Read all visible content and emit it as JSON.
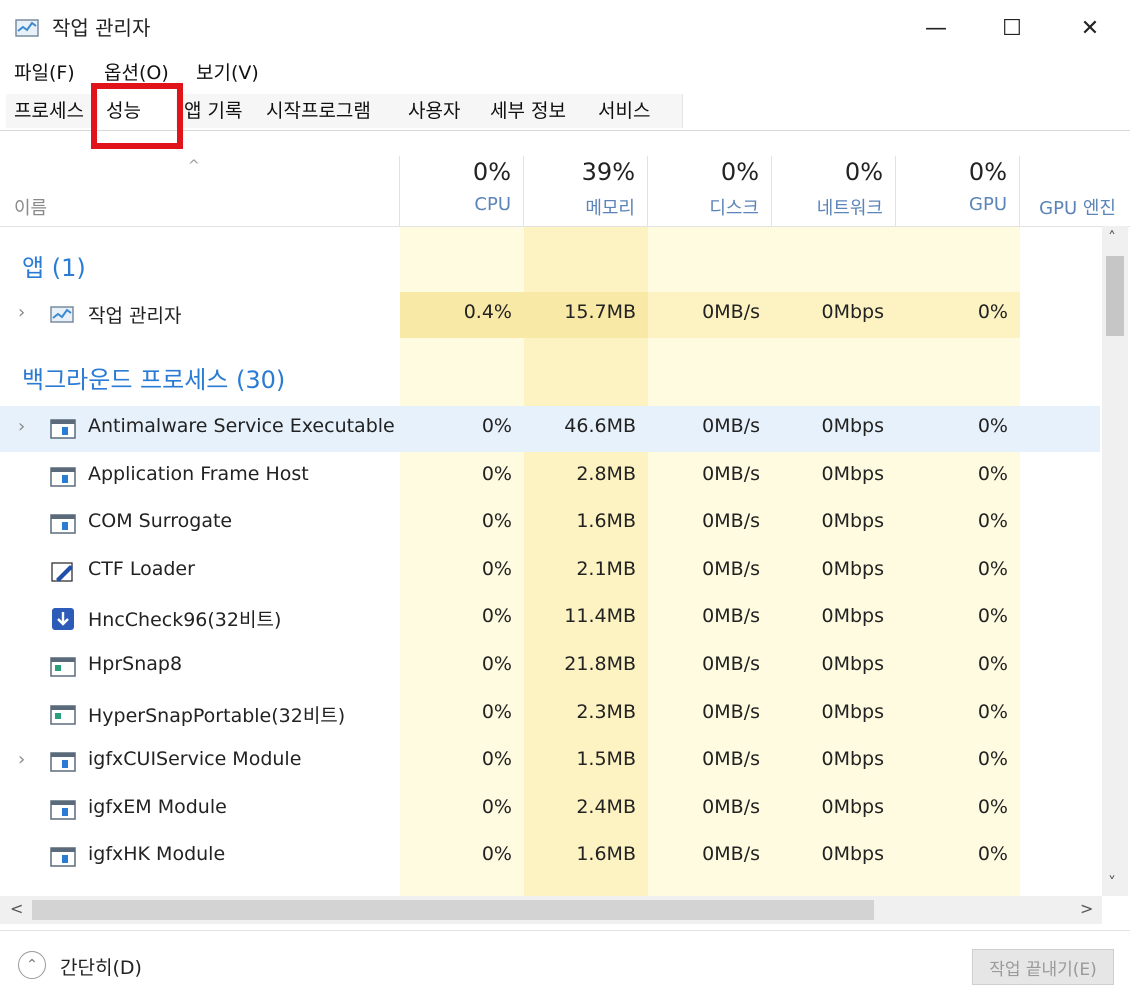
{
  "window": {
    "title": "작업 관리자",
    "minimize": "—",
    "maximize": "☐",
    "close": "✕"
  },
  "menu": [
    "파일(F)",
    "옵션(O)",
    "보기(V)"
  ],
  "tabs": [
    {
      "label": "프로세스",
      "active": false
    },
    {
      "label": "성능",
      "active": true
    },
    {
      "label": "앱 기록",
      "active": false
    },
    {
      "label": "시작프로그램",
      "active": false
    },
    {
      "label": "사용자",
      "active": false
    },
    {
      "label": "세부 정보",
      "active": false
    },
    {
      "label": "서비스",
      "active": false
    }
  ],
  "columns": {
    "name": "이름",
    "sort_caret": "^",
    "cpu": {
      "pct": "0%",
      "label": "CPU"
    },
    "mem": {
      "pct": "39%",
      "label": "메모리"
    },
    "disk": {
      "pct": "0%",
      "label": "디스크"
    },
    "net": {
      "pct": "0%",
      "label": "네트워크"
    },
    "gpu": {
      "pct": "0%",
      "label": "GPU"
    },
    "gpu_engine": {
      "label": "GPU 엔진"
    }
  },
  "groups": {
    "apps": "앱 (1)",
    "background": "백그라운드 프로세스 (30)"
  },
  "app_rows": [
    {
      "name": "작업 관리자",
      "cpu": "0.4%",
      "mem": "15.7MB",
      "disk": "0MB/s",
      "net": "0Mbps",
      "gpu": "0%",
      "expandable": true,
      "icon": "task-manager-icon"
    }
  ],
  "bg_rows": [
    {
      "name": "Antimalware Service Executable",
      "cpu": "0%",
      "mem": "46.6MB",
      "disk": "0MB/s",
      "net": "0Mbps",
      "gpu": "0%",
      "expandable": true,
      "icon": "window-process-icon"
    },
    {
      "name": "Application Frame Host",
      "cpu": "0%",
      "mem": "2.8MB",
      "disk": "0MB/s",
      "net": "0Mbps",
      "gpu": "0%",
      "expandable": false,
      "icon": "window-process-icon"
    },
    {
      "name": "COM Surrogate",
      "cpu": "0%",
      "mem": "1.6MB",
      "disk": "0MB/s",
      "net": "0Mbps",
      "gpu": "0%",
      "expandable": false,
      "icon": "window-process-icon"
    },
    {
      "name": "CTF Loader",
      "cpu": "0%",
      "mem": "2.1MB",
      "disk": "0MB/s",
      "net": "0Mbps",
      "gpu": "0%",
      "expandable": false,
      "icon": "pen-icon"
    },
    {
      "name": "HncCheck96(32비트)",
      "cpu": "0%",
      "mem": "11.4MB",
      "disk": "0MB/s",
      "net": "0Mbps",
      "gpu": "0%",
      "expandable": false,
      "icon": "download-icon"
    },
    {
      "name": "HprSnap8",
      "cpu": "0%",
      "mem": "21.8MB",
      "disk": "0MB/s",
      "net": "0Mbps",
      "gpu": "0%",
      "expandable": false,
      "icon": "snap-icon"
    },
    {
      "name": "HyperSnapPortable(32비트)",
      "cpu": "0%",
      "mem": "2.3MB",
      "disk": "0MB/s",
      "net": "0Mbps",
      "gpu": "0%",
      "expandable": false,
      "icon": "snap-icon"
    },
    {
      "name": "igfxCUIService Module",
      "cpu": "0%",
      "mem": "1.5MB",
      "disk": "0MB/s",
      "net": "0Mbps",
      "gpu": "0%",
      "expandable": true,
      "icon": "window-process-icon"
    },
    {
      "name": "igfxEM Module",
      "cpu": "0%",
      "mem": "2.4MB",
      "disk": "0MB/s",
      "net": "0Mbps",
      "gpu": "0%",
      "expandable": false,
      "icon": "window-process-icon"
    },
    {
      "name": "igfxHK Module",
      "cpu": "0%",
      "mem": "1.6MB",
      "disk": "0MB/s",
      "net": "0Mbps",
      "gpu": "0%",
      "expandable": false,
      "icon": "window-process-icon"
    }
  ],
  "footer": {
    "collapse": "간단히(D)",
    "end_task": "작업 끝내기(E)"
  },
  "scroll": {
    "up": "˄",
    "down": "˅",
    "left": "<",
    "right": ">"
  },
  "colors": {
    "accent": "#2a7bd3",
    "heat_light": "#fffbe0",
    "heat_mid": "#fdf3c2",
    "heat_strong": "#f8eaa6",
    "highlight": "#e0141a"
  }
}
